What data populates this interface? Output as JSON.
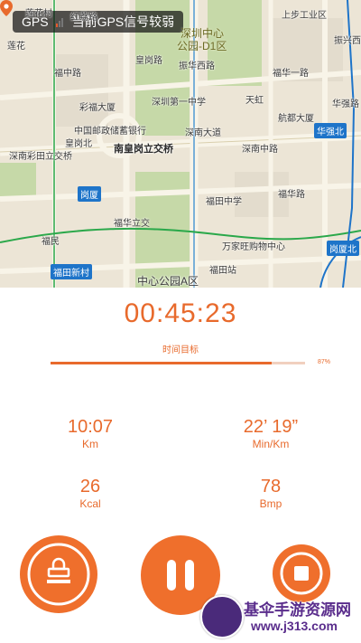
{
  "map": {
    "gps_label": "GPS",
    "gps_status": "当前GPS信号较弱",
    "marker_label": "南皇岗立交桥",
    "labels": [
      "莲花村",
      "莲花",
      "红荔路",
      "深圳中心",
      "公园-D1区",
      "上步工业区",
      "振兴西",
      "华强路",
      "福中路",
      "皇岗路",
      "振华西路",
      "福华一路",
      "皇岗北",
      "深南大道",
      "深南彩田立交桥",
      "岗厦",
      "深南中路",
      "华强北",
      "福华立交",
      "福华路",
      "中心公园A区",
      "福民",
      "福田站",
      "岗厦北",
      "福田新村",
      "中国邮政储蓄银行",
      "深圳第一中学",
      "彩福大厦",
      "福田中学",
      "航都大厦",
      "万家旺购物中心",
      "天虹"
    ]
  },
  "workout": {
    "timer": "00:45:23",
    "goal_label": "时间目标",
    "progress_pct": "87%",
    "progress_value": 87,
    "stats": [
      {
        "value": "10:07",
        "unit": "Km"
      },
      {
        "value": "22’ 19”",
        "unit": "Min/Km"
      },
      {
        "value": "26",
        "unit": "Kcal"
      },
      {
        "value": "78",
        "unit": "Bmp"
      }
    ]
  },
  "controls": {
    "lock": "lock-icon",
    "pause": "pause-icon",
    "stop": "stop-icon"
  },
  "watermark": {
    "title": "基伞手游资源网",
    "url": "www.j313.com"
  },
  "colors": {
    "accent": "#e86a2c",
    "button": "#ef6f2c",
    "map_bg": "#ece5d6",
    "park": "#c6d9a8",
    "metro_green": "#2aa84a",
    "metro_blue": "#1e74c9"
  }
}
